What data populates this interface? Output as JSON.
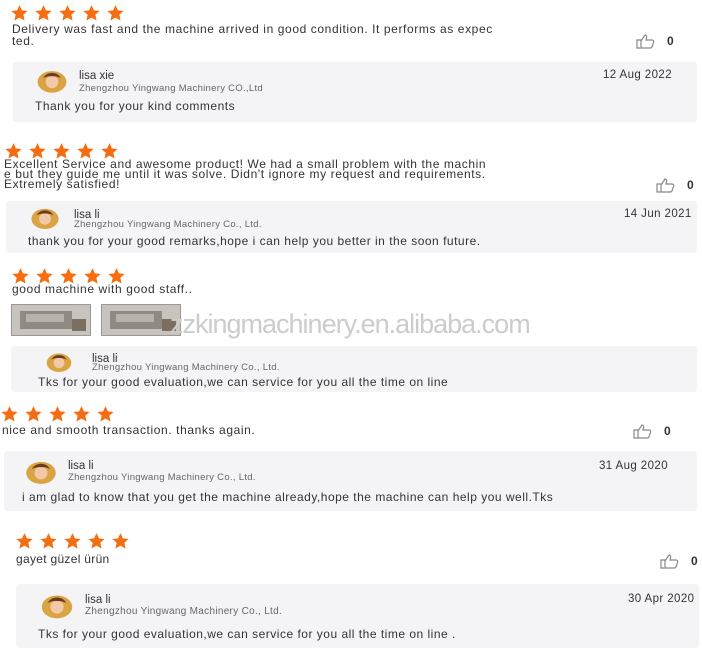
{
  "colors": {
    "star": "#f36e12",
    "reply_bg": "#f4f4f6"
  },
  "icons": {
    "rating": "star-icon",
    "like": "thumbs-up-icon"
  },
  "watermark": "zzkingmachinery.en.alibaba.com",
  "reviews": [
    {
      "rating": 5,
      "text_lines": [
        "Delivery was fast and the machine arrived in good condition. It performs as expec",
        "ted."
      ],
      "likes": "0",
      "reply": {
        "name": "lisa xie",
        "company": "Zhengzhou Yingwang Machinery CO.,Ltd",
        "date": "12 Aug 2022",
        "text": "Thank you for your kind comments"
      }
    },
    {
      "rating": 5,
      "text_lines": [
        "Excellent Service and awesome product! We had a small problem with the machin",
        "e but they guide me until it was solve. Didn't ignore my request and requirements.",
        "Extremely satisfied!"
      ],
      "likes": "0",
      "reply": {
        "name": "lisa li",
        "company": "Zhengzhou Yingwang Machinery Co., Ltd.",
        "date": "14 Jun 2021",
        "text": "thank you for your good remarks,hope i can help you better in the soon future."
      }
    },
    {
      "rating": 5,
      "text_lines": [
        "good machine with good staff.."
      ],
      "reply": {
        "name": "lisa li",
        "company": "Zhengzhou Yingwang Machinery Co., Ltd.",
        "text": "Tks for your good evaluation,we can service for you all the time on line"
      }
    },
    {
      "rating": 5,
      "text_lines": [
        "nice and smooth transaction. thanks again."
      ],
      "likes": "0",
      "reply": {
        "name": "lisa li",
        "company": "Zhengzhou Yingwang Machinery Co., Ltd.",
        "date": "31 Aug 2020",
        "text": "i am glad to know that you get the machine already,hope the machine can help you well.Tks"
      }
    },
    {
      "rating": 5,
      "text_lines": [
        "gayet güzel ürün"
      ],
      "likes": "0",
      "reply": {
        "name": "lisa li",
        "company": "Zhengzhou Yingwang Machinery Co., Ltd.",
        "date": "30 Apr 2020",
        "text": "Tks for your good evaluation,we can service for you all the time on line ."
      }
    }
  ]
}
